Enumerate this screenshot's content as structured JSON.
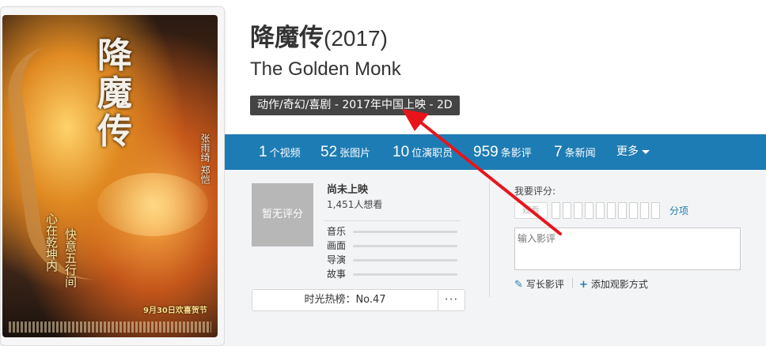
{
  "poster": {
    "title_chars": "降魔传",
    "slogan_a": "心在乾坤内",
    "slogan_b": "快意五行间",
    "release_note": "9月30日欢喜贺节",
    "cast_text": "张雨绮 郑恺"
  },
  "movie": {
    "title_cn": "降魔传",
    "year": "(2017)",
    "title_en": "The Golden Monk",
    "genre_line": "动作/奇幻/喜剧 - 2017年中国上映 - 2D"
  },
  "nav": {
    "videos": {
      "num": "1",
      "label": "个视频"
    },
    "photos": {
      "num": "52",
      "label": "张图片"
    },
    "cast": {
      "num": "10",
      "label": "位演职员"
    },
    "reviews": {
      "num": "959",
      "label": "条影评"
    },
    "news": {
      "num": "7",
      "label": "条新闻"
    },
    "more": "更多"
  },
  "rating": {
    "no_score": "暂无评分",
    "status": "尚未上映",
    "wants": "1,451人想看",
    "dimensions": [
      "音乐",
      "画面",
      "导演",
      "故事"
    ],
    "rank": "时光热榜：No.47",
    "rank_more": "···"
  },
  "my_rating": {
    "label": "我要评分:",
    "star_placeholder": "观看",
    "score_link": "分项",
    "review_placeholder": "输入影评",
    "write_long_review": "写长影评",
    "add_watch_method": "添加观影方式"
  },
  "colors": {
    "nav_bg": "#1e7cb4",
    "genre_bg": "#444444",
    "annotation_arrow": "#e8141c"
  }
}
